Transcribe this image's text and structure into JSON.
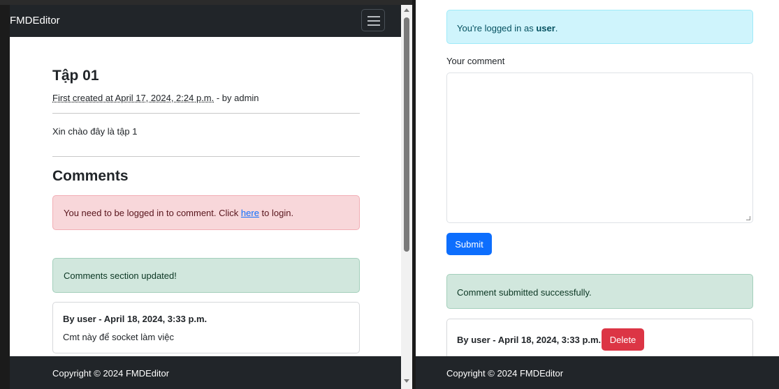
{
  "left": {
    "navbar": {
      "brand": "FMDEditor"
    },
    "post": {
      "title": "Tập 01",
      "meta_created": "First created at April 17, 2024, 2:24 p.m.",
      "meta_by": " - by admin",
      "body": "Xin chào đây là tập 1"
    },
    "comments_heading": "Comments",
    "login_alert": {
      "before": "You need to be logged in to comment. Click ",
      "link": "here",
      "after": " to login."
    },
    "updated_alert": "Comments section updated!",
    "comment": {
      "author": "By user - April 18, 2024, 3:33 p.m.",
      "text": "Cmt này để socket làm việc"
    },
    "footer": "Copyright © 2024 FMDEditor"
  },
  "right": {
    "logged_in_alert": {
      "before": "You're logged in as ",
      "user": "user",
      "after": "."
    },
    "comment_label": "Your comment",
    "comment_value": "",
    "submit_label": "Submit",
    "success_alert": "Comment submitted successfully.",
    "comment": {
      "author": "By user - April 18, 2024, 3:33 p.m.",
      "delete_label": "Delete"
    },
    "footer": "Copyright © 2024 FMDEditor"
  },
  "colors": {
    "navbar": "#212529",
    "primary": "#0d6efd",
    "danger": "#dc3545",
    "alert_danger_bg": "#f8d7da",
    "alert_success_bg": "#d1e7dd",
    "alert_info_bg": "#cff4fc"
  },
  "icons": {
    "toggler": "hamburger-menu-icon"
  }
}
